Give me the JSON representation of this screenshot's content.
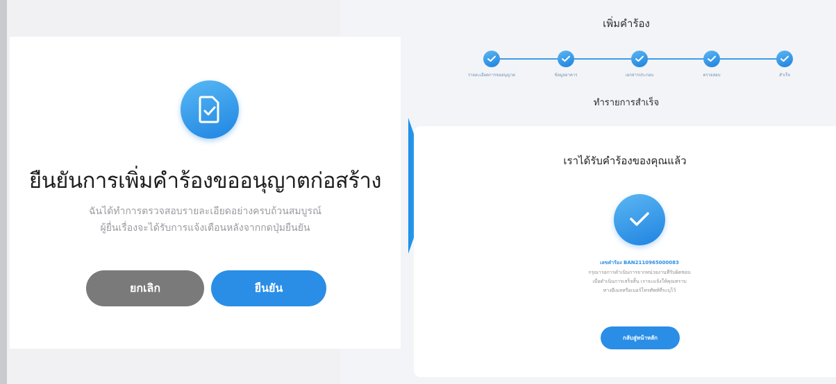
{
  "confirm_dialog": {
    "icon": "document-check-icon",
    "title": "ยืนยันการเพิ่มคำร้องขออนุญาตก่อสร้าง",
    "description_lines": [
      "ฉันได้ทำการตรวจสอบรายละเอียดอย่างครบถ้วนสมบูรณ์",
      "ผู้ยื่นเรื่องจะได้รับการแจ้งเตือนหลังจากกดปุ่มยืนยัน"
    ],
    "cancel_label": "ยกเลิก",
    "confirm_label": "ยืนยัน"
  },
  "transition_arrow": "arrow-right-icon",
  "result_panel": {
    "title": "เพิ่มคำร้อง",
    "steps": [
      {
        "label": "รายละเอียดการขออนุญาต",
        "done": true
      },
      {
        "label": "ข้อมูลอาคาร",
        "done": true
      },
      {
        "label": "เอกสารประกอบ",
        "done": true
      },
      {
        "label": "ตรวจสอบ",
        "done": true
      },
      {
        "label": "สำเร็จ",
        "done": true
      }
    ],
    "status": "ทำรายการสำเร็จ",
    "card": {
      "heading": "เราได้รับคำร้องของคุณแล้ว",
      "icon": "check-icon",
      "reference": "เลขคำร้อง BAN2110965000083",
      "note_lines": [
        "กรุณารอการดำเนินการจากหน่วยงานที่รับผิดชอบ",
        "เมื่อดำเนินการเสร็จสิ้น เราจะแจ้งให้คุณทราบ",
        "ทางอีเมลหรือเบอร์โทรศัพท์ที่ระบุไว้"
      ],
      "home_button": "กลับสู่หน้าหลัก"
    }
  },
  "colors": {
    "accent": "#2a8ee6",
    "cancel": "#7a7a7b",
    "panel_bg": "#f3f4f7"
  }
}
